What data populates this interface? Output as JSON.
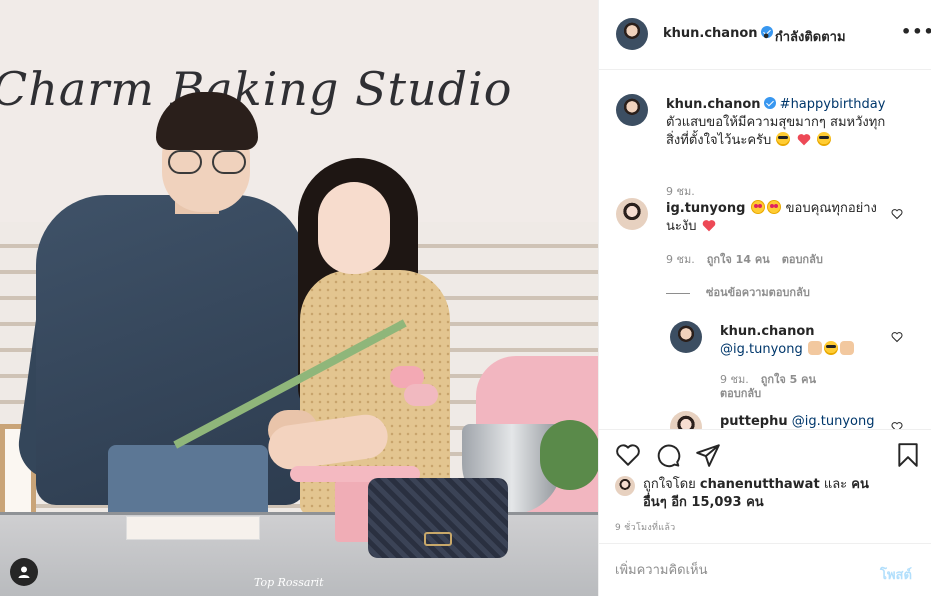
{
  "photo": {
    "sign_text": "Charm Baking Studio",
    "watermark": "Top Rossarit"
  },
  "header": {
    "username": "khun.chanon",
    "follow_status": "• กำลังติดตาม",
    "more": "•••"
  },
  "caption": {
    "username": "khun.chanon",
    "hashtag": "#happybirthday",
    "text": "ตัวแสบขอให้มีความสุขมากๆ สมหวังทุกสิ่งที่ตั้งใจไว้นะครับ",
    "time": "9 ชม."
  },
  "comments": [
    {
      "username": "ig.tunyong",
      "text": "ขอบคุณทุกอย่างนะงับ",
      "time": "9 ชม.",
      "likes": "ถูกใจ 14 คน",
      "reply": "ตอบกลับ"
    }
  ],
  "hide_replies": "ซ่อนข้อความตอบกลับ",
  "replies": [
    {
      "username": "khun.chanon",
      "mention": "@ig.tunyong",
      "time": "9 ชม.",
      "likes": "ถูกใจ 5 คน",
      "reply": "ตอบกลับ"
    },
    {
      "username": "puttephu",
      "mention": "@ig.tunyong"
    }
  ],
  "liked_by": {
    "prefix": "ถูกใจโดย",
    "user": "chanenutthawat",
    "joiner": "และ",
    "others": "คนอื่นๆ อีก 15,093 คน"
  },
  "posted_ago": "9 ชั่วโมงที่แล้ว",
  "composer": {
    "placeholder": "เพิ่มความคิดเห็น",
    "post_label": "โพสต์"
  },
  "colors": {
    "verified": "#3897f0",
    "link": "#00376b",
    "muted": "#8e8e8e",
    "post_disabled": "#b2dffc",
    "heart": "#ed4956"
  }
}
